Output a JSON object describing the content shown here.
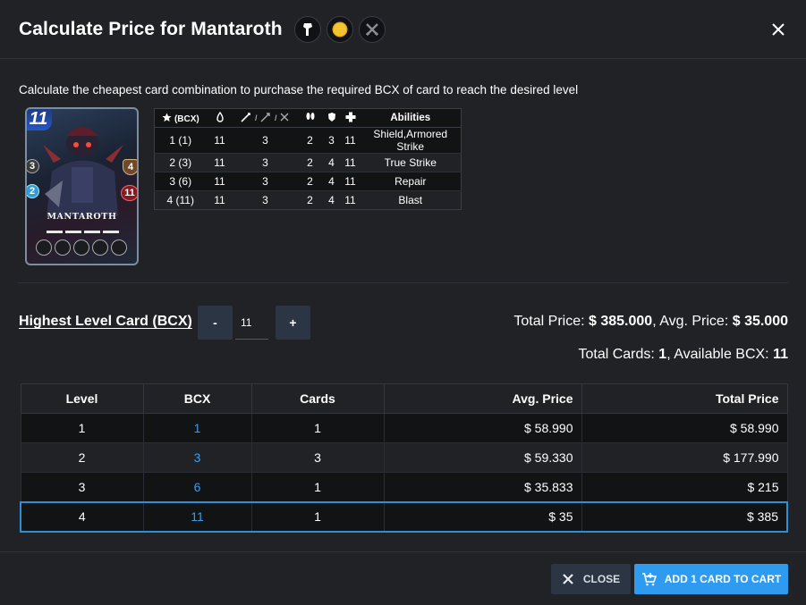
{
  "header": {
    "title": "Calculate Price for Mantaroth",
    "icons": [
      "neutral-element-icon",
      "gold-edition-icon",
      "no-battle-icon"
    ]
  },
  "description": "Calculate the cheapest card combination to purchase the required BCX of card to reach the desired level",
  "card": {
    "name": "MANTAROTH",
    "mana": "11",
    "melee": "3",
    "speed": "2",
    "armor": "4",
    "health": "11",
    "level_badge": "4"
  },
  "stats": {
    "headers": [
      "(BCX)",
      "",
      "",
      "",
      "",
      "",
      "Abilities"
    ],
    "rows": [
      {
        "level": "1 (1)",
        "mana": "11",
        "attack": "3",
        "speed": "2",
        "armor": "3",
        "health": "11",
        "abilities": "Shield,Armored Strike"
      },
      {
        "level": "2 (3)",
        "mana": "11",
        "attack": "3",
        "speed": "2",
        "armor": "4",
        "health": "11",
        "abilities": "True Strike"
      },
      {
        "level": "3 (6)",
        "mana": "11",
        "attack": "3",
        "speed": "2",
        "armor": "4",
        "health": "11",
        "abilities": "Repair"
      },
      {
        "level": "4 (11)",
        "mana": "11",
        "attack": "3",
        "speed": "2",
        "armor": "4",
        "health": "11",
        "abilities": "Blast"
      }
    ]
  },
  "controls": {
    "label": "Highest Level Card (BCX)",
    "minus": "-",
    "plus": "+",
    "value": "11"
  },
  "totals": {
    "total_price_label": "Total Price: ",
    "total_price": "$ 385.000",
    "avg_price_label": ", Avg. Price: ",
    "avg_price": "$ 35.000",
    "total_cards_label": "Total Cards: ",
    "total_cards": "1",
    "available_bcx_label": ", Available BCX: ",
    "available_bcx": "11"
  },
  "price_table": {
    "headers": [
      "Level",
      "BCX",
      "Cards",
      "Avg. Price",
      "Total Price"
    ],
    "rows": [
      {
        "level": "1",
        "bcx": "1",
        "cards": "1",
        "avg": "$ 58.990",
        "total": "$ 58.990"
      },
      {
        "level": "2",
        "bcx": "3",
        "cards": "3",
        "avg": "$ 59.330",
        "total": "$ 177.990"
      },
      {
        "level": "3",
        "bcx": "6",
        "cards": "1",
        "avg": "$ 35.833",
        "total": "$ 215"
      },
      {
        "level": "4",
        "bcx": "11",
        "cards": "1",
        "avg": "$ 35",
        "total": "$ 385"
      }
    ]
  },
  "footer": {
    "close_label": "CLOSE",
    "cart_label": "ADD 1 CARD TO CART"
  },
  "colors": {
    "accent": "#2e9bf0",
    "bcx_link": "#3d9be9",
    "selected_border": "#2e8fd6"
  }
}
